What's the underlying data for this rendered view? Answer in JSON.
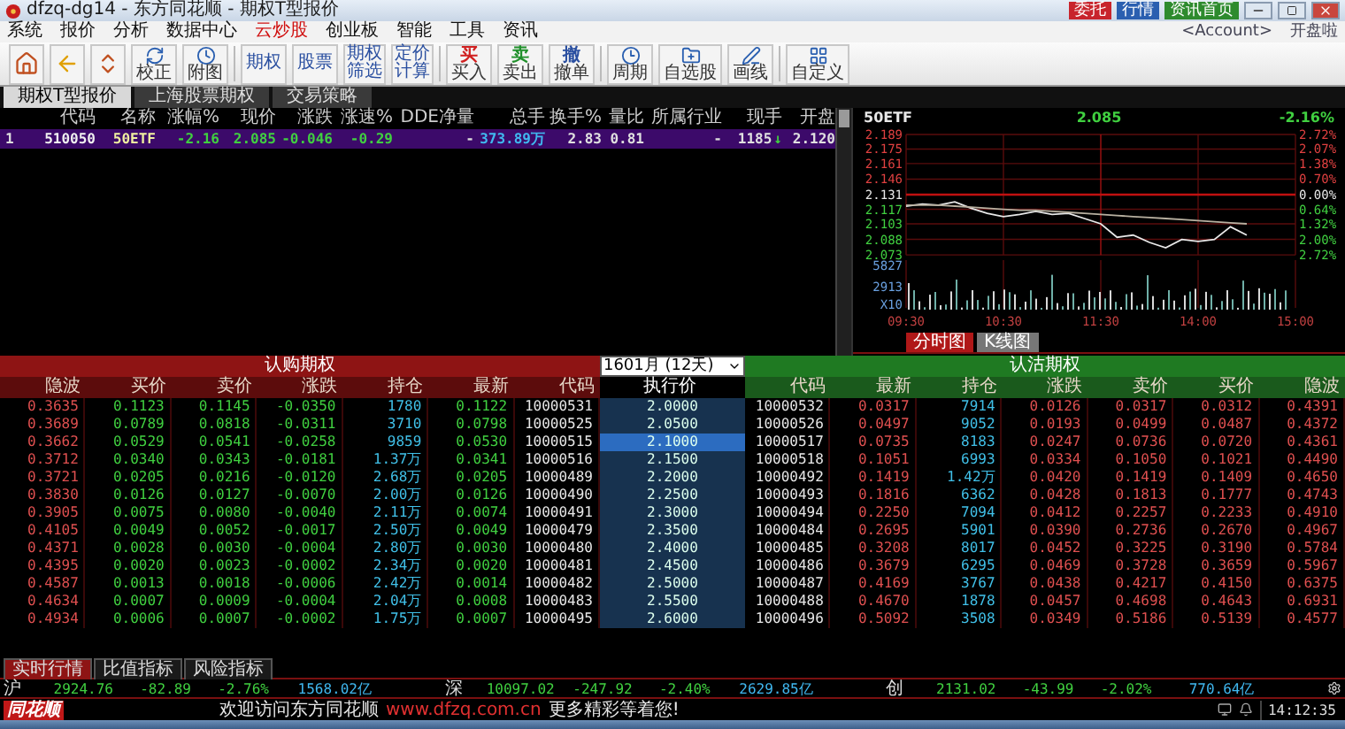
{
  "window": {
    "title": "dfzq-dg14 - 东方同花顺 - 期权T型报价"
  },
  "quick_links": [
    {
      "label": "委托",
      "color": "#c8242c"
    },
    {
      "label": "行情",
      "color": "#2a5fb0"
    },
    {
      "label": "资讯首页",
      "color": "#2e8b2e"
    }
  ],
  "account": {
    "label": "<Account>",
    "status": "开盘啦"
  },
  "menu": [
    {
      "label": "系统",
      "highlight": false
    },
    {
      "label": "报价",
      "highlight": false
    },
    {
      "label": "分析",
      "highlight": false
    },
    {
      "label": "数据中心",
      "highlight": false
    },
    {
      "label": "云炒股",
      "highlight": true
    },
    {
      "label": "创业板",
      "highlight": false
    },
    {
      "label": "智能",
      "highlight": false
    },
    {
      "label": "工具",
      "highlight": false
    },
    {
      "label": "资讯",
      "highlight": false
    }
  ],
  "toolbar": [
    {
      "kind": "icon"
    },
    {
      "kind": "icon"
    },
    {
      "kind": "icon"
    },
    {
      "kind": "labeled",
      "label": "校正"
    },
    {
      "kind": "labeled",
      "label": "附图"
    },
    {
      "kind": "text",
      "label": "期权"
    },
    {
      "kind": "text",
      "label": "股票"
    },
    {
      "kind": "text",
      "label": "期权筛选"
    },
    {
      "kind": "text",
      "label": "定价计算"
    },
    {
      "kind": "glyph",
      "glyph": "买",
      "label": "买入",
      "color": "#d02020"
    },
    {
      "kind": "glyph",
      "glyph": "卖",
      "label": "卖出",
      "color": "#1f8f2a"
    },
    {
      "kind": "glyph",
      "glyph": "撤",
      "label": "撤单",
      "color": "#2a4fa0"
    },
    {
      "kind": "labeled",
      "label": "周期"
    },
    {
      "kind": "labeled",
      "label": "自选股"
    },
    {
      "kind": "labeled",
      "label": "画线"
    },
    {
      "kind": "labeled",
      "label": "自定义"
    }
  ],
  "tabs": [
    {
      "label": "期权T型报价",
      "selected": true
    },
    {
      "label": "上海股票期权",
      "selected": false
    },
    {
      "label": "交易策略",
      "selected": false
    }
  ],
  "quote_table": {
    "columns": [
      "代码",
      "名称",
      "涨幅%",
      "现价",
      "涨跌",
      "涨速%",
      "DDE净量",
      "总手",
      "换手%",
      "量比",
      "所属行业",
      "现手",
      "开盘"
    ],
    "rows": [
      {
        "index": "1",
        "selected": true,
        "volume_arrow": "↓",
        "cells": [
          "510050",
          "50ETF",
          "-2.16",
          "2.085",
          "-0.046",
          "-0.29",
          "-",
          "373.89万",
          "2.83",
          "0.81",
          "-",
          "1185",
          "2.120"
        ]
      }
    ]
  },
  "chart": {
    "name": "50ETF",
    "price": "2.085",
    "change": "-2.16%",
    "right_axis_labels": [
      "2.72%",
      "2.07%",
      "1.38%",
      "0.70%",
      "0.00%",
      "0.64%",
      "1.32%",
      "2.00%",
      "2.72%"
    ],
    "volume_labels": [
      "5827",
      "2913",
      "X10"
    ],
    "chart_data": {
      "type": "line",
      "ylim": [
        2.022,
        2.189
      ],
      "grid": true,
      "ref_lines": [
        {
          "axis": "y",
          "value": 2.131
        }
      ],
      "categories": [
        "09:30",
        null,
        null,
        null,
        null,
        null,
        "10:30",
        null,
        null,
        null,
        null,
        null,
        "11:30",
        null,
        null,
        null,
        null,
        null,
        "14:00",
        null,
        null,
        null,
        null,
        null,
        "15:00"
      ],
      "yticks": [
        {
          "value": 2.189,
          "label": "2.189"
        },
        {
          "value": 2.175,
          "label": "2.175"
        },
        {
          "value": 2.161,
          "label": "2.161"
        },
        {
          "value": 2.146,
          "label": "2.146"
        },
        {
          "value": 2.131,
          "label": "2.131"
        },
        {
          "value": 2.117,
          "label": "2.117"
        },
        {
          "value": 2.103,
          "label": "2.103"
        },
        {
          "value": 2.088,
          "label": "2.088"
        },
        {
          "value": 2.073,
          "label": "2.073"
        }
      ],
      "series": [
        {
          "color": "#e8e8e8",
          "values": [
            2.12,
            2.122,
            2.121,
            2.124,
            2.118,
            2.113,
            2.11,
            2.112,
            2.115,
            2.112,
            2.113,
            2.108,
            2.103,
            2.09,
            2.092,
            2.085,
            2.08,
            2.088,
            2.086,
            2.088,
            2.1,
            2.092,
            null,
            null,
            null
          ]
        },
        {
          "color": "#b8b0a0",
          "values": [
            2.121,
            2.121,
            2.121,
            2.12,
            2.119,
            2.118,
            2.117,
            2.116,
            2.116,
            2.115,
            2.114,
            2.113,
            2.112,
            2.111,
            2.11,
            2.109,
            2.108,
            2.107,
            2.106,
            2.105,
            2.104,
            2.103,
            null,
            null,
            null
          ]
        }
      ]
    },
    "tabs": [
      {
        "label": "分时图",
        "selected": true
      },
      {
        "label": "K线图",
        "selected": false
      }
    ]
  },
  "options": {
    "call_title": "认购期权",
    "put_title": "认沽期权",
    "expiry": "1601月 (12天)",
    "call_columns": [
      "隐波",
      "买价",
      "卖价",
      "涨跌",
      "持仓",
      "最新",
      "代码"
    ],
    "strike_column": "执行价",
    "put_columns": [
      "代码",
      "最新",
      "持仓",
      "涨跌",
      "卖价",
      "买价",
      "隐波"
    ],
    "rows": [
      {
        "strike": "2.0000",
        "selected": false,
        "call": [
          "0.3635",
          "0.1123",
          "0.1145",
          "-0.0350",
          "1780",
          "0.1122",
          "10000531"
        ],
        "put": [
          "10000532",
          "0.0317",
          "7914",
          "0.0126",
          "0.0317",
          "0.0312",
          "0.4391"
        ]
      },
      {
        "strike": "2.0500",
        "selected": false,
        "call": [
          "0.3689",
          "0.0789",
          "0.0818",
          "-0.0311",
          "3710",
          "0.0798",
          "10000525"
        ],
        "put": [
          "10000526",
          "0.0497",
          "9052",
          "0.0193",
          "0.0499",
          "0.0487",
          "0.4372"
        ]
      },
      {
        "strike": "2.1000",
        "selected": true,
        "call": [
          "0.3662",
          "0.0529",
          "0.0541",
          "-0.0258",
          "9859",
          "0.0530",
          "10000515"
        ],
        "put": [
          "10000517",
          "0.0735",
          "8183",
          "0.0247",
          "0.0736",
          "0.0720",
          "0.4361"
        ]
      },
      {
        "strike": "2.1500",
        "selected": false,
        "call": [
          "0.3712",
          "0.0340",
          "0.0343",
          "-0.0181",
          "1.37万",
          "0.0341",
          "10000516"
        ],
        "put": [
          "10000518",
          "0.1051",
          "6993",
          "0.0334",
          "0.1050",
          "0.1021",
          "0.4490"
        ]
      },
      {
        "strike": "2.2000",
        "selected": false,
        "call": [
          "0.3721",
          "0.0205",
          "0.0216",
          "-0.0120",
          "2.68万",
          "0.0205",
          "10000489"
        ],
        "put": [
          "10000492",
          "0.1419",
          "1.42万",
          "0.0420",
          "0.1419",
          "0.1409",
          "0.4650"
        ]
      },
      {
        "strike": "2.2500",
        "selected": false,
        "call": [
          "0.3830",
          "0.0126",
          "0.0127",
          "-0.0070",
          "2.00万",
          "0.0126",
          "10000490"
        ],
        "put": [
          "10000493",
          "0.1816",
          "6362",
          "0.0428",
          "0.1813",
          "0.1777",
          "0.4743"
        ]
      },
      {
        "strike": "2.3000",
        "selected": false,
        "call": [
          "0.3905",
          "0.0075",
          "0.0080",
          "-0.0040",
          "2.11万",
          "0.0074",
          "10000491"
        ],
        "put": [
          "10000494",
          "0.2250",
          "7094",
          "0.0412",
          "0.2257",
          "0.2233",
          "0.4910"
        ]
      },
      {
        "strike": "2.3500",
        "selected": false,
        "call": [
          "0.4105",
          "0.0049",
          "0.0052",
          "-0.0017",
          "2.50万",
          "0.0049",
          "10000479"
        ],
        "put": [
          "10000484",
          "0.2695",
          "5901",
          "0.0390",
          "0.2736",
          "0.2670",
          "0.4967"
        ]
      },
      {
        "strike": "2.4000",
        "selected": false,
        "call": [
          "0.4371",
          "0.0028",
          "0.0030",
          "-0.0004",
          "2.80万",
          "0.0030",
          "10000480"
        ],
        "put": [
          "10000485",
          "0.3208",
          "8017",
          "0.0452",
          "0.3225",
          "0.3190",
          "0.5784"
        ]
      },
      {
        "strike": "2.4500",
        "selected": false,
        "call": [
          "0.4395",
          "0.0020",
          "0.0023",
          "-0.0002",
          "2.34万",
          "0.0020",
          "10000481"
        ],
        "put": [
          "10000486",
          "0.3679",
          "6295",
          "0.0469",
          "0.3728",
          "0.3659",
          "0.5967"
        ]
      },
      {
        "strike": "2.5000",
        "selected": false,
        "call": [
          "0.4587",
          "0.0013",
          "0.0018",
          "-0.0006",
          "2.42万",
          "0.0014",
          "10000482"
        ],
        "put": [
          "10000487",
          "0.4169",
          "3767",
          "0.0438",
          "0.4217",
          "0.4150",
          "0.6375"
        ]
      },
      {
        "strike": "2.5500",
        "selected": false,
        "call": [
          "0.4634",
          "0.0007",
          "0.0009",
          "-0.0004",
          "2.04万",
          "0.0008",
          "10000483"
        ],
        "put": [
          "10000488",
          "0.4670",
          "1878",
          "0.0457",
          "0.4698",
          "0.4643",
          "0.6931"
        ]
      },
      {
        "strike": "2.6000",
        "selected": false,
        "call": [
          "0.4934",
          "0.0006",
          "0.0007",
          "-0.0002",
          "1.75万",
          "0.0007",
          "10000495"
        ],
        "put": [
          "10000496",
          "0.5092",
          "3508",
          "0.0349",
          "0.5186",
          "0.5139",
          "0.4577"
        ]
      }
    ]
  },
  "bottom_tabs": [
    {
      "label": "实时行情",
      "selected": true
    },
    {
      "label": "比值指标",
      "selected": false
    },
    {
      "label": "风险指标",
      "selected": false
    }
  ],
  "index_bar": [
    {
      "market": "沪",
      "values": [
        "2924.76",
        "-82.89",
        "-2.76%",
        "1568.02亿"
      ]
    },
    {
      "market": "深",
      "values": [
        "10097.02",
        "-247.92",
        "-2.40%",
        "2629.85亿"
      ]
    },
    {
      "market": "创",
      "values": [
        "2131.02",
        "-43.99",
        "-2.02%",
        "770.64亿"
      ]
    }
  ],
  "status_bar": {
    "logo": "同花顺",
    "welcome": "欢迎访问东方同花顺",
    "url": "www.dfzq.com.cn",
    "slogan": "更多精彩等着您!",
    "time": "14:12:35"
  }
}
